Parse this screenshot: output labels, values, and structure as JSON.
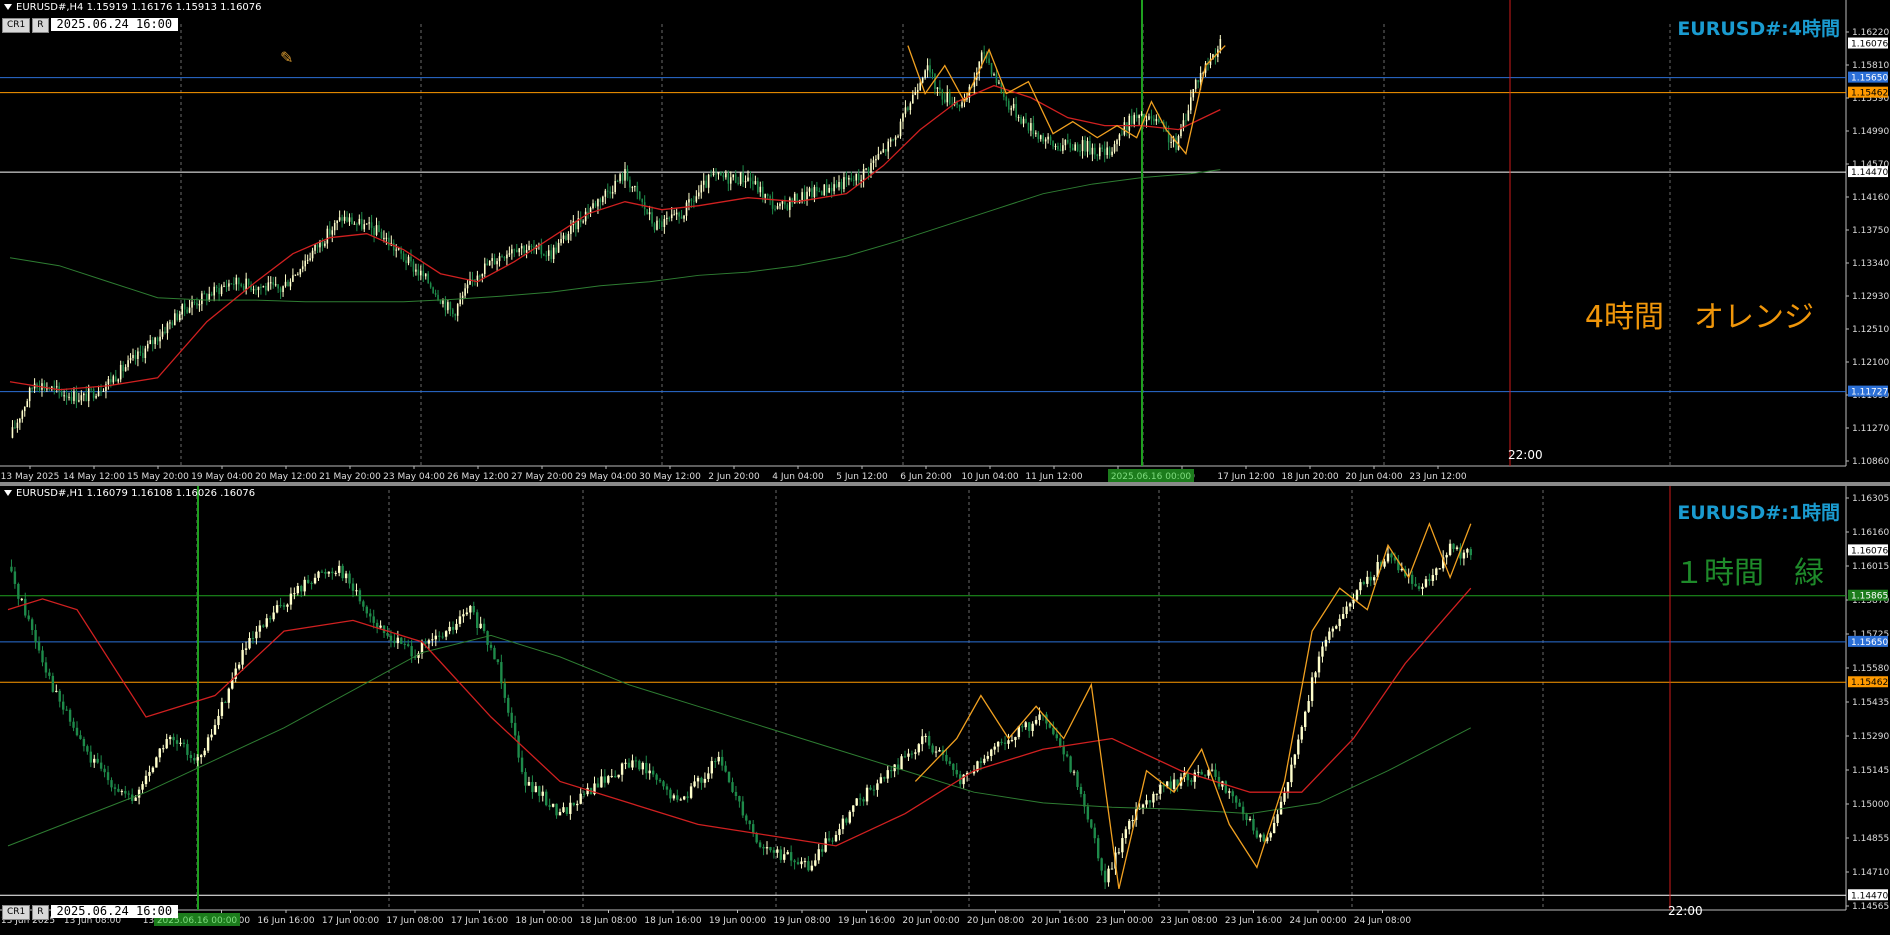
{
  "colors": {
    "background": "#000000",
    "grid": "#6a6a6a",
    "bull_candle": "#ffffcc",
    "bear_candle": "#1e8a4a",
    "ma_red": "#d02020",
    "ma_green": "#2e7d32",
    "zigzag_orange": "#f0a020",
    "blue_line": "#2b6fd6",
    "orange_line": "#ff9a00",
    "white_line": "#ffffff",
    "red_vline": "#d11a1a",
    "green_vline": "#1fa01f",
    "watermark": "#1a9bd0",
    "note_orange": "#f0960a",
    "note_green": "#1e8a2a"
  },
  "top": {
    "header": "EURUSD#,H4  1.15919 1.16176 1.15913 1.16076",
    "btn1": "CR1",
    "btn2": "R",
    "date": "2025.06.24  16:00",
    "watermark": "EURUSD#:4時間",
    "note": "4時間　オレンジ",
    "vline_label": "22:00",
    "marked_time": "2025.06.16 00:00",
    "levels": {
      "blue_upper": "1.15650",
      "orange": "1.15462",
      "white": "1.14470",
      "blue_lower": "1.11727",
      "last": "1.16076"
    },
    "price_ticks": [
      "1.16220",
      "1.15810",
      "1.15390",
      "1.14990",
      "1.14570",
      "1.14160",
      "1.13750",
      "1.13340",
      "1.12930",
      "1.12510",
      "1.12100",
      "1.11690",
      "1.11270",
      "1.10860"
    ],
    "time_ticks": [
      "13 May 2025",
      "14 May 12:00",
      "15 May 20:00",
      "19 May 04:00",
      "20 May 12:00",
      "21 May 20:00",
      "23 May 04:00",
      "26 May 12:00",
      "27 May 20:00",
      "29 May 04:00",
      "30 May 12:00",
      "2 Jun 20:00",
      "4 Jun 04:00",
      "5 Jun 12:00",
      "6 Jun 20:00",
      "10 Jun 04:00",
      "11 Jun 12:00",
      "12 J",
      "04:00",
      "17 Jun 12:00",
      "18 Jun 20:00",
      "20 Jun 04:00",
      "23 Jun 12:00"
    ]
  },
  "bottom": {
    "header": "EURUSD#,H1  1.16079 1.16108 1.16026 .16076",
    "btn1": "CR1",
    "btn2": "R",
    "date": "2025.06.24  16:00",
    "watermark": "EURUSD#:1時間",
    "note": "１時間　緑",
    "vline_label": "22:00",
    "marked_time": "2025.06.16 00:00",
    "levels": {
      "green": "1.15865",
      "blue": "1.15650",
      "orange": "1.15462",
      "white": "1.14470",
      "last": "1.16076"
    },
    "price_ticks": [
      "1.16305",
      "1.16160",
      "1.16015",
      "1.15870",
      "1.15725",
      "1.15580",
      "1.15435",
      "1.15290",
      "1.15145",
      "1.15000",
      "1.14855",
      "1.14710",
      "1.14565"
    ],
    "time_ticks": [
      "13 Jun 2025",
      "13 Jun 08:00",
      "13 Jun",
      "16 Jun 08:00",
      "16 Jun 16:00",
      "17 Jun 00:00",
      "17 Jun 08:00",
      "17 Jun 16:00",
      "18 Jun 00:00",
      "18 Jun 08:00",
      "18 Jun 16:00",
      "19 Jun 00:00",
      "19 Jun 08:00",
      "19 Jun 16:00",
      "20 Jun 00:00",
      "20 Jun 08:00",
      "20 Jun 16:00",
      "23 Jun 00:00",
      "23 Jun 08:00",
      "23 Jun 16:00",
      "24 Jun 00:00",
      "24 Jun 08:00"
    ]
  },
  "chart_data": [
    {
      "type": "candlestick",
      "symbol": "EURUSD#",
      "timeframe": "H4",
      "ylim": [
        1.1086,
        1.1622
      ],
      "close_path": [
        [
          0,
          1.1115
        ],
        [
          10,
          1.1185
        ],
        [
          20,
          1.1172
        ],
        [
          30,
          1.1165
        ],
        [
          40,
          1.1185
        ],
        [
          55,
          1.1225
        ],
        [
          70,
          1.1275
        ],
        [
          90,
          1.131
        ],
        [
          100,
          1.1305
        ],
        [
          110,
          1.13
        ],
        [
          125,
          1.1355
        ],
        [
          135,
          1.139
        ],
        [
          150,
          1.1372
        ],
        [
          160,
          1.134
        ],
        [
          170,
          1.131
        ],
        [
          180,
          1.127
        ],
        [
          190,
          1.1322
        ],
        [
          205,
          1.1355
        ],
        [
          220,
          1.1345
        ],
        [
          235,
          1.14
        ],
        [
          250,
          1.1445
        ],
        [
          262,
          1.138
        ],
        [
          272,
          1.139
        ],
        [
          285,
          1.144
        ],
        [
          300,
          1.144
        ],
        [
          312,
          1.14
        ],
        [
          320,
          1.1415
        ],
        [
          335,
          1.143
        ],
        [
          345,
          1.144
        ],
        [
          360,
          1.149
        ],
        [
          372,
          1.158
        ],
        [
          378,
          1.1545
        ],
        [
          388,
          1.153
        ],
        [
          396,
          1.1598
        ],
        [
          405,
          1.1535
        ],
        [
          414,
          1.1505
        ],
        [
          424,
          1.148
        ],
        [
          436,
          1.148
        ],
        [
          446,
          1.147
        ],
        [
          456,
          1.1515
        ],
        [
          466,
          1.151
        ],
        [
          474,
          1.1478
        ],
        [
          482,
          1.156
        ],
        [
          492,
          1.1608
        ]
      ],
      "ma_red_path": [
        [
          0,
          1.1185
        ],
        [
          20,
          1.1175
        ],
        [
          40,
          1.118
        ],
        [
          60,
          1.119
        ],
        [
          80,
          1.126
        ],
        [
          100,
          1.131
        ],
        [
          115,
          1.1345
        ],
        [
          130,
          1.1365
        ],
        [
          145,
          1.137
        ],
        [
          160,
          1.135
        ],
        [
          175,
          1.132
        ],
        [
          190,
          1.131
        ],
        [
          205,
          1.1335
        ],
        [
          220,
          1.1365
        ],
        [
          235,
          1.1395
        ],
        [
          250,
          1.141
        ],
        [
          265,
          1.14
        ],
        [
          280,
          1.1405
        ],
        [
          300,
          1.1415
        ],
        [
          320,
          1.141
        ],
        [
          340,
          1.142
        ],
        [
          355,
          1.1455
        ],
        [
          370,
          1.15
        ],
        [
          385,
          1.1535
        ],
        [
          400,
          1.1555
        ],
        [
          415,
          1.154
        ],
        [
          430,
          1.1515
        ],
        [
          445,
          1.1505
        ],
        [
          460,
          1.1505
        ],
        [
          475,
          1.15
        ],
        [
          492,
          1.1525
        ]
      ],
      "ma_green_path": [
        [
          0,
          1.134
        ],
        [
          20,
          1.133
        ],
        [
          40,
          1.131
        ],
        [
          60,
          1.129
        ],
        [
          80,
          1.1287
        ],
        [
          100,
          1.1287
        ],
        [
          120,
          1.1285
        ],
        [
          140,
          1.1285
        ],
        [
          160,
          1.1285
        ],
        [
          180,
          1.1288
        ],
        [
          200,
          1.1292
        ],
        [
          220,
          1.1297
        ],
        [
          240,
          1.1305
        ],
        [
          260,
          1.131
        ],
        [
          280,
          1.1318
        ],
        [
          300,
          1.1322
        ],
        [
          320,
          1.133
        ],
        [
          340,
          1.1342
        ],
        [
          360,
          1.136
        ],
        [
          380,
          1.138
        ],
        [
          400,
          1.14
        ],
        [
          420,
          1.142
        ],
        [
          440,
          1.1432
        ],
        [
          460,
          1.144
        ],
        [
          480,
          1.1445
        ],
        [
          492,
          1.145
        ]
      ],
      "zigzag": [
        [
          365,
          1.1605
        ],
        [
          372,
          1.1545
        ],
        [
          380,
          1.158
        ],
        [
          388,
          1.1535
        ],
        [
          398,
          1.16
        ],
        [
          405,
          1.1545
        ],
        [
          414,
          1.156
        ],
        [
          424,
          1.1495
        ],
        [
          432,
          1.151
        ],
        [
          442,
          1.149
        ],
        [
          450,
          1.1505
        ],
        [
          458,
          1.149
        ],
        [
          464,
          1.1535
        ],
        [
          470,
          1.15
        ],
        [
          478,
          1.147
        ],
        [
          486,
          1.158
        ],
        [
          494,
          1.1605
        ]
      ]
    },
    {
      "type": "candlestick",
      "symbol": "EURUSD#",
      "timeframe": "H1",
      "ylim": [
        1.1442,
        1.1632
      ],
      "close_path": [
        [
          0,
          1.16
        ],
        [
          6,
          1.1575
        ],
        [
          14,
          1.154
        ],
        [
          24,
          1.151
        ],
        [
          36,
          1.149
        ],
        [
          46,
          1.152
        ],
        [
          56,
          1.151
        ],
        [
          68,
          1.156
        ],
        [
          78,
          1.158
        ],
        [
          88,
          1.1595
        ],
        [
          96,
          1.16
        ],
        [
          108,
          1.157
        ],
        [
          118,
          1.156
        ],
        [
          128,
          1.157
        ],
        [
          134,
          1.158
        ],
        [
          142,
          1.1555
        ],
        [
          150,
          1.15
        ],
        [
          160,
          1.1485
        ],
        [
          172,
          1.15
        ],
        [
          182,
          1.151
        ],
        [
          194,
          1.149
        ],
        [
          206,
          1.151
        ],
        [
          218,
          1.147
        ],
        [
          232,
          1.146
        ],
        [
          246,
          1.149
        ],
        [
          256,
          1.1505
        ],
        [
          266,
          1.152
        ],
        [
          276,
          1.15
        ],
        [
          290,
          1.152
        ],
        [
          300,
          1.153
        ],
        [
          310,
          1.15
        ],
        [
          318,
          1.1455
        ],
        [
          328,
          1.149
        ],
        [
          338,
          1.15
        ],
        [
          348,
          1.1505
        ],
        [
          356,
          1.149
        ],
        [
          364,
          1.147
        ],
        [
          372,
          1.1505
        ],
        [
          380,
          1.156
        ],
        [
          386,
          1.1575
        ],
        [
          392,
          1.159
        ],
        [
          400,
          1.1605
        ],
        [
          410,
          1.159
        ],
        [
          418,
          1.1608
        ],
        [
          424,
          1.1605
        ]
      ],
      "ma_red_path": [
        [
          0,
          1.158
        ],
        [
          10,
          1.1585
        ],
        [
          20,
          1.158
        ],
        [
          40,
          1.153
        ],
        [
          60,
          1.154
        ],
        [
          80,
          1.157
        ],
        [
          100,
          1.1575
        ],
        [
          120,
          1.1565
        ],
        [
          140,
          1.153
        ],
        [
          160,
          1.15
        ],
        [
          180,
          1.149
        ],
        [
          200,
          1.148
        ],
        [
          220,
          1.1475
        ],
        [
          240,
          1.147
        ],
        [
          260,
          1.1485
        ],
        [
          280,
          1.1505
        ],
        [
          300,
          1.1515
        ],
        [
          320,
          1.152
        ],
        [
          340,
          1.1505
        ],
        [
          360,
          1.1495
        ],
        [
          375,
          1.1495
        ],
        [
          390,
          1.152
        ],
        [
          405,
          1.1555
        ],
        [
          424,
          1.159
        ]
      ],
      "ma_green_path": [
        [
          0,
          1.147
        ],
        [
          40,
          1.1495
        ],
        [
          80,
          1.1525
        ],
        [
          120,
          1.156
        ],
        [
          140,
          1.1568
        ],
        [
          160,
          1.1558
        ],
        [
          180,
          1.1545
        ],
        [
          200,
          1.1535
        ],
        [
          220,
          1.1525
        ],
        [
          240,
          1.1515
        ],
        [
          260,
          1.1505
        ],
        [
          280,
          1.1495
        ],
        [
          300,
          1.149
        ],
        [
          320,
          1.1488
        ],
        [
          340,
          1.1487
        ],
        [
          360,
          1.1485
        ],
        [
          380,
          1.149
        ],
        [
          400,
          1.1505
        ],
        [
          424,
          1.1525
        ]
      ],
      "zigzag": [
        [
          263,
          1.15
        ],
        [
          275,
          1.152
        ],
        [
          282,
          1.154
        ],
        [
          290,
          1.152
        ],
        [
          298,
          1.1535
        ],
        [
          306,
          1.152
        ],
        [
          314,
          1.1545
        ],
        [
          322,
          1.145
        ],
        [
          330,
          1.1505
        ],
        [
          338,
          1.1495
        ],
        [
          346,
          1.1515
        ],
        [
          354,
          1.148
        ],
        [
          362,
          1.146
        ],
        [
          370,
          1.15
        ],
        [
          378,
          1.157
        ],
        [
          386,
          1.159
        ],
        [
          394,
          1.158
        ],
        [
          400,
          1.161
        ],
        [
          406,
          1.1595
        ],
        [
          412,
          1.162
        ],
        [
          418,
          1.1595
        ],
        [
          424,
          1.162
        ]
      ]
    }
  ]
}
